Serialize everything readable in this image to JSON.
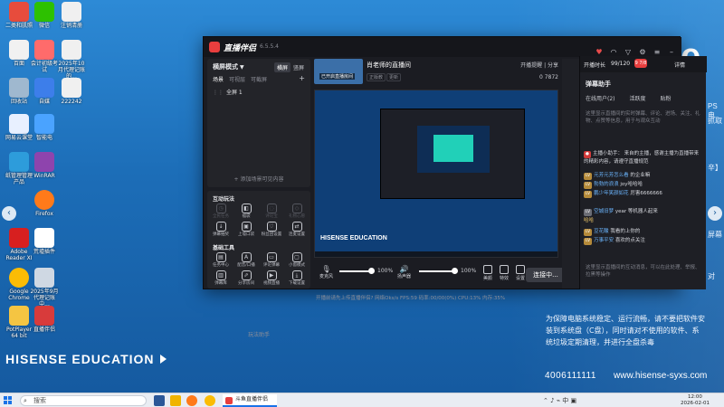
{
  "desktop": {
    "icons": [
      {
        "label": "二类和肌照",
        "color": "#e74c3c"
      },
      {
        "label": "百面",
        "color": "#f1f1f1"
      },
      {
        "label": "回收站",
        "color": "#9fb8cf"
      },
      {
        "label": "网易云课堂",
        "color": "#e8f0ff"
      },
      {
        "label": "纸管理管理产品",
        "color": "#2d9cdb"
      },
      {
        "label": "Firefox",
        "color": "#ff7a1a"
      },
      {
        "label": "Adobe Reader XI",
        "color": "#d71f1f"
      },
      {
        "label": "Google Chrome",
        "color": "#fbbc05"
      },
      {
        "label": "PotPlayer 64 bit",
        "color": "#f5c542"
      },
      {
        "label": "微信",
        "color": "#2dc100"
      },
      {
        "label": "会计初级考试",
        "color": "#ff6b6b"
      },
      {
        "label": "自媒",
        "color": "#3d7eea"
      },
      {
        "label": "智能电",
        "color": "#4aa3ff"
      },
      {
        "label": "WinRAR",
        "color": "#8e44ad"
      },
      {
        "label": "荒墟插件",
        "color": "#ffffff"
      },
      {
        "label": "2025年9月代理记账中...",
        "color": "#cfd8e3"
      },
      {
        "label": "直播伴侣",
        "color": "#d83b3b"
      },
      {
        "label": "注销清册",
        "color": "#f0f0f0"
      },
      {
        "label": "2025年10月代理记账的...",
        "color": "#f0f0f0"
      },
      {
        "label": "222242",
        "color": "#f0f0f0"
      }
    ],
    "wallpaper": {
      "logo_text": "e",
      "brand": "HISENSE EDUCATION",
      "phone": "4006111111",
      "website": "www.hisense-syxs.com",
      "notice": "为保障电脑系统稳定、运行流畅，请不要把软件安装到系统盘（C盘），同时请对不使用的软件、系统垃圾定期清理，并进行全盘杀毒",
      "fragments": [
        "PS电",
        "抓取",
        "辛】",
        "屏幕",
        "对"
      ]
    }
  },
  "app": {
    "title": "直播伴侣",
    "version": "6.5.5.4",
    "titlebar_icons": [
      "heart-icon",
      "headset-icon",
      "shirt-icon",
      "settings-icon",
      "menu-icon",
      "minimize-icon",
      "maximize-icon",
      "close-icon"
    ],
    "scene": {
      "mode_label": "横屏模式",
      "toggle": [
        "横屏",
        "竖屏"
      ],
      "tabs": [
        "场景",
        "可视层",
        "可截屏"
      ],
      "item": "全屏 1",
      "more": "+ 添加场景可见内容"
    },
    "interaction": {
      "title": "互动玩法",
      "tools": [
        {
          "label": "全民任务",
          "dim": true
        },
        {
          "label": "福袋",
          "dim": false
        },
        {
          "label": "评论宝",
          "dim": true
        },
        {
          "label": "礼物心愿",
          "dim": true
        },
        {
          "label": "弹幕抽奖",
          "dim": false
        },
        {
          "label": "上墙口袋",
          "dim": false
        },
        {
          "label": "粉丝团设置",
          "dim": false
        },
        {
          "label": "连麦设置",
          "dim": false
        }
      ]
    },
    "basic": {
      "title": "基础工具",
      "tools": [
        {
          "label": "任务中心"
        },
        {
          "label": "配音/口播"
        },
        {
          "label": "评论弹幕"
        },
        {
          "label": "小窗模式"
        },
        {
          "label": "弹幕库"
        },
        {
          "label": "分享房间"
        },
        {
          "label": "视频直播"
        },
        {
          "label": "下载设置"
        }
      ],
      "more": "玩法助手"
    },
    "room": {
      "thumb_badge": "已开启直播房间",
      "name": "肖老师的直播间",
      "tags": [
        "正版教",
        "更新"
      ],
      "header_right": "开播提醒 | 分享",
      "stats": "0   7872"
    },
    "preview_brand": "HISENSE EDUCATION",
    "controls": {
      "mic_label": "麦克风",
      "mic_pct": "100%",
      "speaker_label": "扬声器",
      "speaker_pct": "100%",
      "icons": [
        "美颜",
        "特效",
        "设置"
      ],
      "go_live": "连接中..."
    },
    "status": "开播前请先上传直播伴侣?    网络Oks/s    FPS:59    码率:00/00(0%)    CPU:13%    内存:35%"
  },
  "side": {
    "top": [
      "开播时长",
      "99/120",
      "9 7/8",
      "详情"
    ],
    "title": "弹幕助手",
    "tabs": [
      "在线用户(2)",
      "活跃度",
      "贴粉"
    ],
    "tip": "这里显示直播间的实时弹幕、评论、进场、关注、礼物、点赞等信息，用于与观众互动",
    "chats": [
      {
        "level": "",
        "text": "主播小助手：  来自的主播，感谢主播为直播带来的精彩内容，请遵守直播规范",
        "kind": "system"
      },
      {
        "level": "LV",
        "name": "元芳元芳怎么看",
        "text": "的企业嘛"
      },
      {
        "level": "LV",
        "name": "勃勃的浪浪",
        "text": "joy哈哈哈"
      },
      {
        "level": "LV",
        "name": "鹏少年笑颜如花",
        "text": "厉害6666666"
      },
      {
        "level": "LV",
        "name": "空城旧梦",
        "text": "year  等机器人起来"
      },
      {
        "level": "",
        "name": "哈哈",
        "text": ""
      },
      {
        "level": "LV",
        "name": "豆花酸",
        "text": "我看的上你的"
      },
      {
        "level": "LV",
        "name": "万事平安",
        "text": "喜欢的点关注"
      }
    ],
    "foot": "这里显示直播间的互动消息，可以在此处理、举报、拉黑等操作"
  },
  "taskbar": {
    "search_placeholder": "搜索",
    "active_task": "斗鱼直播伴侣",
    "time": "12:00",
    "date": "2026-02-01"
  }
}
